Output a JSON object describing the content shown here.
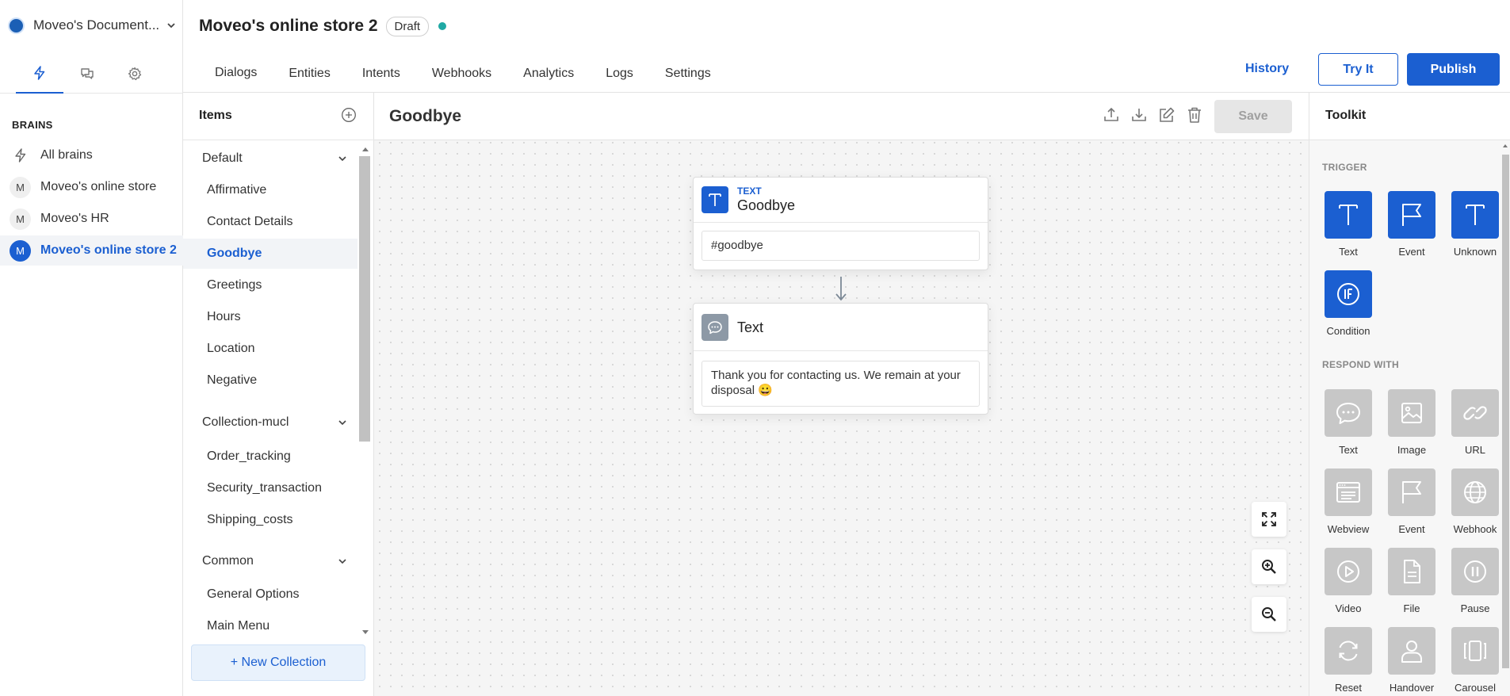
{
  "workspace": {
    "name": "Moveo's Document..."
  },
  "sidebar": {
    "brains_title": "BRAINS",
    "items": [
      {
        "label": "All brains",
        "avatar": ""
      },
      {
        "label": "Moveo's online store",
        "avatar": "M"
      },
      {
        "label": "Moveo's HR",
        "avatar": "M"
      },
      {
        "label": "Moveo's online store 2",
        "avatar": "M"
      }
    ],
    "active_item": "Moveo's online store 2"
  },
  "header": {
    "title": "Moveo's online store 2",
    "status_badge": "Draft",
    "status_color": "#1fa9a4",
    "tabs": [
      "Dialogs",
      "Entities",
      "Intents",
      "Webhooks",
      "Analytics",
      "Logs",
      "Settings"
    ],
    "active_tab": "Dialogs",
    "history_label": "History",
    "try_label": "Try It",
    "publish_label": "Publish"
  },
  "items_panel": {
    "title": "Items",
    "groups": [
      {
        "name": "Default",
        "items": [
          "Affirmative",
          "Contact Details",
          "Goodbye",
          "Greetings",
          "Hours",
          "Location",
          "Negative"
        ]
      },
      {
        "name": "Collection-mucl",
        "items": [
          "Order_tracking",
          "Security_transaction",
          "Shipping_costs"
        ]
      },
      {
        "name": "Common",
        "items": [
          "General Options",
          "Main Menu"
        ]
      }
    ],
    "active_item": "Goodbye",
    "new_collection_label": "+ New Collection"
  },
  "canvas": {
    "dialog_title": "Goodbye",
    "save_label": "Save",
    "trigger_card": {
      "type_label": "TEXT",
      "title": "Goodbye",
      "value": "#goodbye"
    },
    "response_card": {
      "title": "Text",
      "message": "Thank you for contacting us. We remain at your disposal",
      "emoji": "😀"
    }
  },
  "toolkit": {
    "title": "Toolkit",
    "trigger_section": "TRIGGER",
    "triggers": [
      {
        "label": "Text",
        "icon": "text-t-icon"
      },
      {
        "label": "Event",
        "icon": "flag-icon"
      },
      {
        "label": "Unknown",
        "icon": "text-t-icon"
      },
      {
        "label": "Condition",
        "icon": "condition-if-icon"
      }
    ],
    "respond_section": "RESPOND WITH",
    "responses": [
      {
        "label": "Text",
        "icon": "chat-bubble-icon"
      },
      {
        "label": "Image",
        "icon": "image-icon"
      },
      {
        "label": "URL",
        "icon": "link-icon"
      },
      {
        "label": "Webview",
        "icon": "webview-icon"
      },
      {
        "label": "Event",
        "icon": "flag-icon"
      },
      {
        "label": "Webhook",
        "icon": "globe-icon"
      },
      {
        "label": "Video",
        "icon": "play-icon"
      },
      {
        "label": "File",
        "icon": "file-icon"
      },
      {
        "label": "Pause",
        "icon": "pause-icon"
      },
      {
        "label": "Reset",
        "icon": "reset-icon"
      },
      {
        "label": "Handover",
        "icon": "person-icon"
      },
      {
        "label": "Carousel",
        "icon": "carousel-icon"
      }
    ]
  },
  "colors": {
    "accent": "#1b5fd1",
    "tool_grey": "#c7c7c7",
    "response_icon": "#8d99a6"
  }
}
